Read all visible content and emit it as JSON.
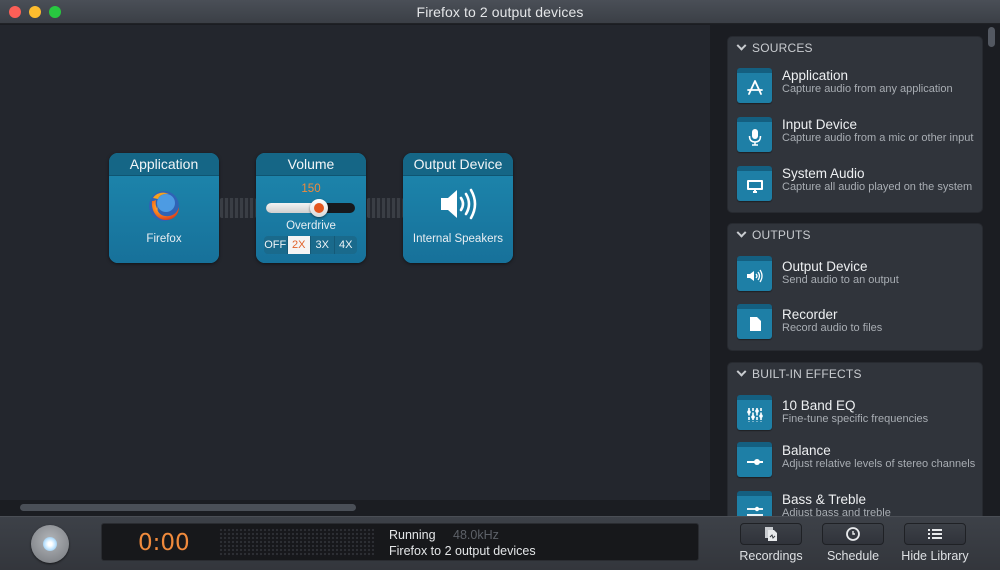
{
  "window": {
    "title": "Firefox to 2 output devices"
  },
  "canvas": {
    "nodes": [
      {
        "header": "Application",
        "label": "Firefox",
        "icon": "firefox-icon"
      },
      {
        "header": "Volume",
        "value": "150",
        "level_percent": 60,
        "overdrive_label": "Overdrive",
        "overdrive_options": [
          "OFF",
          "2X",
          "3X",
          "4X"
        ],
        "overdrive_selected": "2X"
      },
      {
        "header": "Output Device",
        "label": "Internal Speakers",
        "icon": "speaker-icon"
      }
    ]
  },
  "library": {
    "sections": [
      {
        "title": "SOURCES",
        "items": [
          {
            "title": "Application",
            "desc": "Capture audio from any application",
            "icon": "app-store-icon"
          },
          {
            "title": "Input Device",
            "desc": "Capture audio from a mic or other input",
            "icon": "microphone-icon"
          },
          {
            "title": "System Audio",
            "desc": "Capture all audio played on the system",
            "icon": "monitor-icon"
          }
        ]
      },
      {
        "title": "OUTPUTS",
        "items": [
          {
            "title": "Output Device",
            "desc": "Send audio to an output",
            "icon": "speaker-icon"
          },
          {
            "title": "Recorder",
            "desc": "Record audio to files",
            "icon": "document-icon"
          }
        ]
      },
      {
        "title": "BUILT-IN EFFECTS",
        "items": [
          {
            "title": "10 Band EQ",
            "desc": "Fine-tune specific frequencies",
            "icon": "equalizer-icon"
          },
          {
            "title": "Balance",
            "desc": "Adjust relative levels of stereo channels",
            "icon": "balance-icon"
          },
          {
            "title": "Bass & Treble",
            "desc": "Adjust bass and treble",
            "icon": "bass-treble-icon"
          }
        ]
      }
    ]
  },
  "bottombar": {
    "time": "0:00",
    "status": "Running",
    "sample_rate": "48.0kHz",
    "session_name": "Firefox to 2 output devices",
    "buttons": [
      {
        "label": "Recordings",
        "icon": "recordings-icon"
      },
      {
        "label": "Schedule",
        "icon": "clock-icon"
      },
      {
        "label": "Hide Library",
        "icon": "list-icon"
      }
    ]
  },
  "colors": {
    "accent_orange": "#f08a3c",
    "node_blue": "#1b7ea4"
  }
}
